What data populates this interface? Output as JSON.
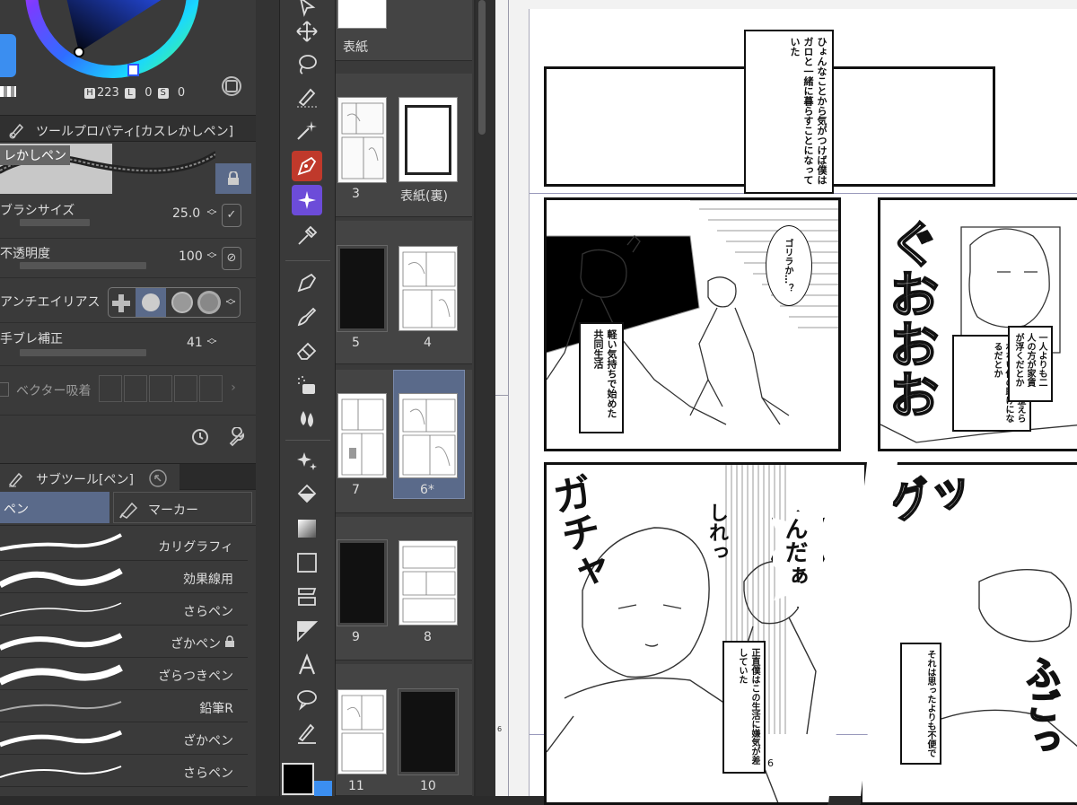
{
  "color": {
    "h": "223",
    "s": "0",
    "v": "0",
    "tags": {
      "h": "H",
      "l": "L",
      "s": "S"
    },
    "main_color": "#3b8ef0"
  },
  "tool_property": {
    "title": "ツールプロパティ[カスレかしペン]",
    "brush_preview_label": "レかしペン",
    "rows": [
      {
        "label": "ブラシサイズ",
        "value": "25.0"
      },
      {
        "label": "不透明度",
        "value": "100"
      },
      {
        "label": "アンチエイリアス",
        "value": ""
      },
      {
        "label": "手ブレ補正",
        "value": "41"
      }
    ],
    "vector_label": "ベクター吸着"
  },
  "subtool": {
    "title": "サブツール[ペン]",
    "tabs": [
      {
        "label": "ペン"
      },
      {
        "label": "マーカー"
      }
    ],
    "brushes": [
      {
        "name": "カリグラフィ"
      },
      {
        "name": "効果線用"
      },
      {
        "name": "さらペン"
      },
      {
        "name": "ざかペン"
      },
      {
        "name": "ざらつきペン"
      },
      {
        "name": "鉛筆R"
      },
      {
        "name": "ざかペン"
      },
      {
        "name": "さらペン"
      }
    ]
  },
  "pages": [
    {
      "label": "表紙"
    },
    {
      "label": "3"
    },
    {
      "label": "表紙(裏)"
    },
    {
      "label": "5"
    },
    {
      "label": "4"
    },
    {
      "label": "7"
    },
    {
      "label": "6*"
    },
    {
      "label": "9"
    },
    {
      "label": "8"
    },
    {
      "label": "11"
    },
    {
      "label": "10"
    }
  ],
  "manga": {
    "captions": [
      "ひょんなことから気がつけば僕はガロと一緒に暮らすことになっていた",
      "ゴリラか…？",
      "軽い気持ちで始めた共同生活",
      "一人よりも二人の方が家賃が浮くだとか",
      "生活リズムを整えられない僕の助けになるだとか",
      "正直僕はこの生活に嫌気が差していた",
      "それは思ったよりも不便で"
    ],
    "sfx": [
      "ぐおおお",
      "しれっ",
      "んだぁ",
      "グッ",
      "ガチャ",
      "ふごっ"
    ],
    "page_number": "6",
    "margin_number": "6"
  }
}
